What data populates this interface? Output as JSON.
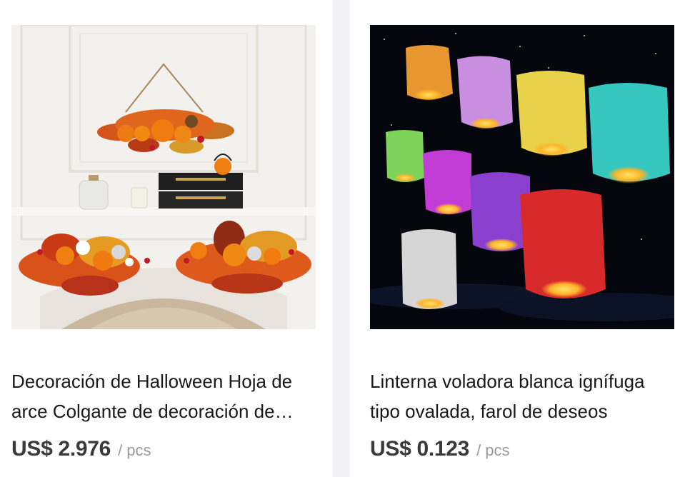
{
  "products": [
    {
      "title": "Decoración de Halloween Hoja de arce Colgante de decoración de calabaza",
      "price": "US$ 2.976",
      "unit": "/ pcs",
      "image_alt": "Halloween maple leaf and pumpkin hanging decoration"
    },
    {
      "title": "Linterna voladora blanca ignífuga tipo ovalada, farol de deseos",
      "price": "US$ 0.123",
      "unit": "/ pcs",
      "image_alt": "Colorful flying sky lanterns at night"
    }
  ],
  "colors": {
    "page_bg": "#f2f2f4",
    "card_bg": "#ffffff",
    "title_text": "#191919",
    "price_text": "#3a3a3a",
    "unit_text": "#9a9a9a",
    "lantern_colors": [
      "#e8962f",
      "#c88fe0",
      "#e8d24a",
      "#35c7c0",
      "#7fd35a",
      "#c23dd6",
      "#8a3fcf",
      "#d82a2a",
      "#d6d6d6"
    ]
  }
}
